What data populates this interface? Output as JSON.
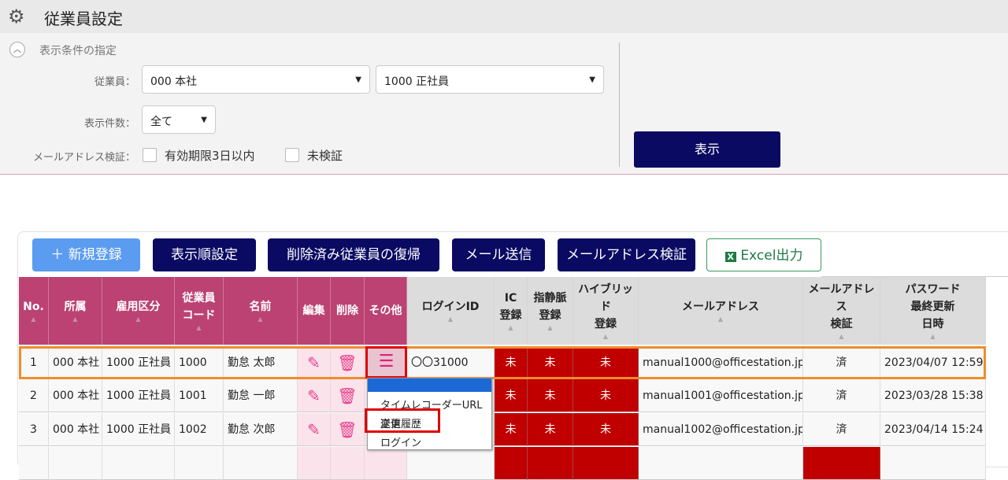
{
  "header": {
    "title": "従業員設定",
    "icon": "gear-icon"
  },
  "filter": {
    "section_label": "表示条件の指定",
    "employee_label": "従業員：",
    "office_value": "000 本社",
    "type_value": "1000 正社員",
    "count_label": "表示件数：",
    "count_value": "全て",
    "email_label": "メールアドレス検証：",
    "cb1": "有効期限3日以内",
    "cb2": "未検証",
    "show_button": "表示"
  },
  "toolbar": {
    "new": "＋ 新規登録",
    "order": "表示順設定",
    "restore": "削除済み従業員の復帰",
    "mail": "メール送信",
    "verify": "メールアドレス検証",
    "excel": "Excel出力"
  },
  "columns": [
    [
      "No."
    ],
    [
      "所属"
    ],
    [
      "雇用区分"
    ],
    [
      "従業員",
      "コード"
    ],
    [
      "名前"
    ],
    [
      "編集"
    ],
    [
      "削除"
    ],
    [
      "その他"
    ],
    [
      "ログインID"
    ],
    [
      "IC",
      "登録"
    ],
    [
      "指静脈",
      "登録"
    ],
    [
      "ハイブリッド",
      "登録"
    ],
    [
      "メールアドレス"
    ],
    [
      "メールアドレス",
      "検証"
    ],
    [
      "パスワード",
      "最終更新",
      "日時"
    ]
  ],
  "rows": [
    {
      "no": "1",
      "office": "000 本社",
      "type": "1000 正社員",
      "code": "1000",
      "name": "勤怠 太郎",
      "login": "〇〇31000",
      "ic": "未",
      "vein": "未",
      "hybrid": "未",
      "email": "manual1000@officestation.jp",
      "verified": "済",
      "updated": "2023/04/07 12:59"
    },
    {
      "no": "2",
      "office": "000 本社",
      "type": "1000 正社員",
      "code": "1001",
      "name": "勤怠 一郎",
      "login": "",
      "ic": "未",
      "vein": "未",
      "hybrid": "未",
      "email": "manual1001@officestation.jp",
      "verified": "済",
      "updated": "2023/03/28 15:38"
    },
    {
      "no": "3",
      "office": "000 本社",
      "type": "1000 正社員",
      "code": "1002",
      "name": "勤怠 次郎",
      "login": "",
      "ic": "未",
      "vein": "未",
      "hybrid": "未",
      "email": "manual1002@officestation.jp",
      "verified": "済",
      "updated": "2023/04/14 15:24"
    }
  ],
  "menu": {
    "items": [
      "タイムレコーダーURL送信",
      "変更履歴",
      "ログイン"
    ]
  },
  "colors": {
    "accent": "#0a0a63",
    "header_pink": "#bb4272",
    "alert_red": "#c00000",
    "highlight": "#ef8c2c"
  }
}
